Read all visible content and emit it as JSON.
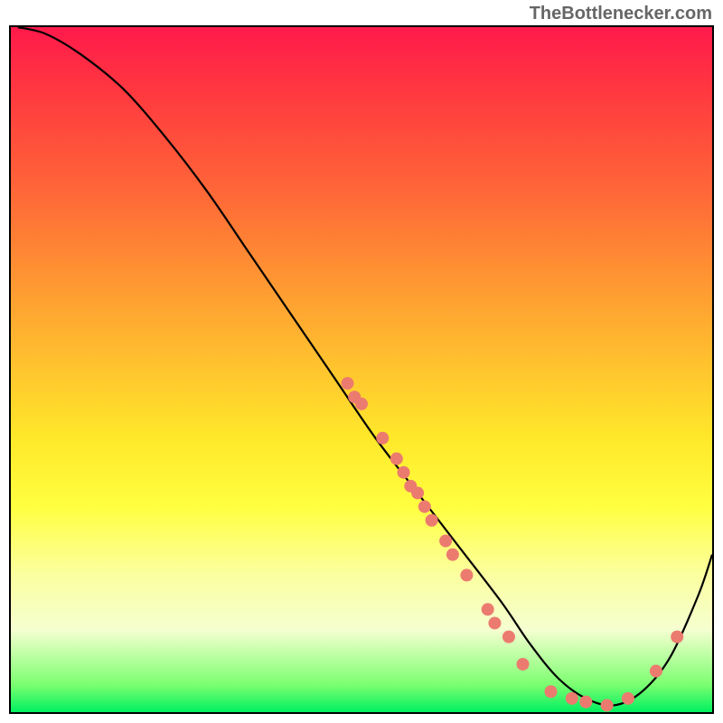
{
  "credit_text": "TheBottlenecker.com",
  "chart_data": {
    "type": "line",
    "title": "",
    "xlabel": "",
    "ylabel": "",
    "xlim": [
      0,
      100
    ],
    "ylim": [
      0,
      100
    ],
    "curve": {
      "x": [
        1,
        5,
        10,
        16,
        22,
        28,
        34,
        40,
        46,
        52,
        58,
        64,
        70,
        74,
        78,
        82,
        86,
        90,
        94,
        98,
        100
      ],
      "y": [
        100,
        99,
        96,
        91,
        84,
        76,
        67,
        58,
        49,
        40,
        32,
        24,
        16,
        10,
        5,
        2,
        1,
        3,
        8,
        17,
        23
      ]
    },
    "markers": [
      {
        "x": 48,
        "y": 48
      },
      {
        "x": 49,
        "y": 46
      },
      {
        "x": 50,
        "y": 45
      },
      {
        "x": 53,
        "y": 40
      },
      {
        "x": 55,
        "y": 37
      },
      {
        "x": 56,
        "y": 35
      },
      {
        "x": 57,
        "y": 33
      },
      {
        "x": 58,
        "y": 32
      },
      {
        "x": 59,
        "y": 30
      },
      {
        "x": 60,
        "y": 28
      },
      {
        "x": 62,
        "y": 25
      },
      {
        "x": 63,
        "y": 23
      },
      {
        "x": 65,
        "y": 20
      },
      {
        "x": 68,
        "y": 15
      },
      {
        "x": 69,
        "y": 13
      },
      {
        "x": 71,
        "y": 11
      },
      {
        "x": 73,
        "y": 7
      },
      {
        "x": 77,
        "y": 3
      },
      {
        "x": 80,
        "y": 2
      },
      {
        "x": 82,
        "y": 1.5
      },
      {
        "x": 85,
        "y": 1
      },
      {
        "x": 88,
        "y": 2
      },
      {
        "x": 92,
        "y": 6
      },
      {
        "x": 95,
        "y": 11
      }
    ],
    "marker_color": "#ec7b6f",
    "marker_radius_px": 7
  }
}
